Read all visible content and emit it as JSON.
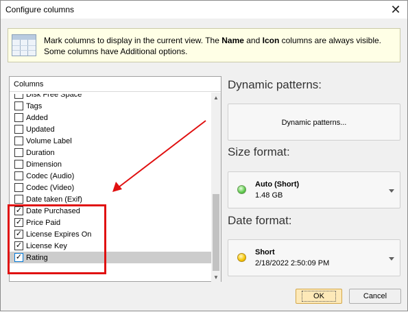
{
  "window": {
    "title": "Configure columns",
    "close_glyph": "✕"
  },
  "info": {
    "text_before_name": "Mark columns to display in the current view. The ",
    "name": "Name",
    "text_and": " and ",
    "icon": "Icon",
    "text_after": " columns are always visible.",
    "line2": "Some columns have Additional options.",
    "icon_name": "table-grid-icon"
  },
  "columns_list": {
    "header": "Columns",
    "items": [
      {
        "label": "Disk Free Space",
        "checked": false
      },
      {
        "label": "Tags",
        "checked": false
      },
      {
        "label": "Added",
        "checked": false
      },
      {
        "label": "Updated",
        "checked": false
      },
      {
        "label": "Volume Label",
        "checked": false
      },
      {
        "label": "Duration",
        "checked": false
      },
      {
        "label": "Dimension",
        "checked": false
      },
      {
        "label": "Codec (Audio)",
        "checked": false
      },
      {
        "label": "Codec (Video)",
        "checked": false
      },
      {
        "label": "Date taken (Exif)",
        "checked": false
      },
      {
        "label": "Date Purchased",
        "checked": true
      },
      {
        "label": "Price Paid",
        "checked": true
      },
      {
        "label": "License Expires On",
        "checked": true
      },
      {
        "label": "License Key",
        "checked": true
      },
      {
        "label": "Rating",
        "checked": true,
        "selected": true
      }
    ]
  },
  "dynamic_patterns": {
    "heading": "Dynamic patterns:",
    "button_label": "Dynamic patterns..."
  },
  "size_format": {
    "heading": "Size format:",
    "title": "Auto (Short)",
    "sample": "1.48 GB",
    "indicator_color": "#5cc84a"
  },
  "date_format": {
    "heading": "Date format:",
    "title": "Short",
    "sample": "2/18/2022 2:50:09 PM",
    "indicator_color": "#f5c400"
  },
  "footer": {
    "ok_label": "OK",
    "cancel_label": "Cancel"
  },
  "annotation": {
    "color": "#e01010"
  }
}
